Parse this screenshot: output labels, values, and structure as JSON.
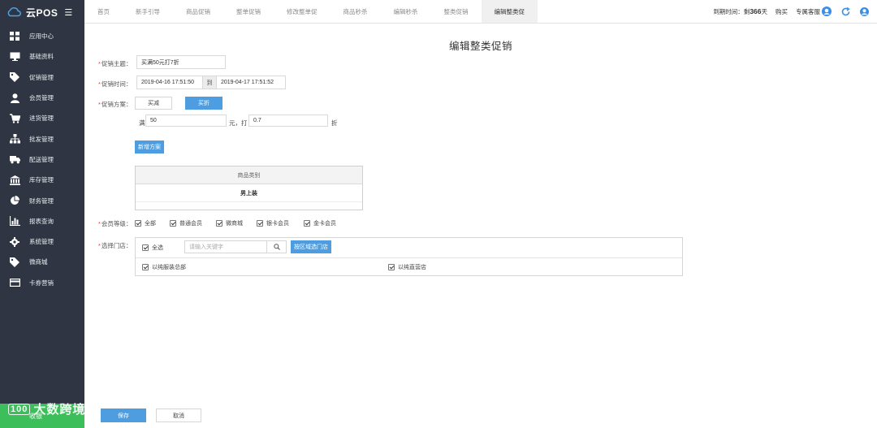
{
  "brand": {
    "name": "云POS"
  },
  "sidebar": {
    "items": [
      {
        "label": "应用中心",
        "icon": "grid-icon"
      },
      {
        "label": "基础资料",
        "icon": "monitor-icon"
      },
      {
        "label": "促销管理",
        "icon": "tag-icon"
      },
      {
        "label": "会员管理",
        "icon": "user-icon"
      },
      {
        "label": "进货管理",
        "icon": "cart-icon"
      },
      {
        "label": "批发管理",
        "icon": "org-chart-icon"
      },
      {
        "label": "配送管理",
        "icon": "truck-icon"
      },
      {
        "label": "库存管理",
        "icon": "bank-icon"
      },
      {
        "label": "财务管理",
        "icon": "pie-chart-icon"
      },
      {
        "label": "报表查询",
        "icon": "bar-chart-icon"
      },
      {
        "label": "系统管理",
        "icon": "gear-icon"
      },
      {
        "label": "微商城",
        "icon": "tag-icon"
      },
      {
        "label": "卡券营销",
        "icon": "card-icon"
      }
    ],
    "cashier_label": "收银"
  },
  "topbar": {
    "tabs": [
      {
        "label": "首页",
        "active": false
      },
      {
        "label": "新手引导",
        "active": false
      },
      {
        "label": "商品促销",
        "active": false
      },
      {
        "label": "整单促销",
        "active": false
      },
      {
        "label": "修改整单促",
        "active": false
      },
      {
        "label": "商品秒杀",
        "active": false
      },
      {
        "label": "编辑秒杀",
        "active": false
      },
      {
        "label": "整类促销",
        "active": false
      },
      {
        "label": "编辑整类促",
        "active": true
      }
    ],
    "expiry_prefix": "到期时间：剩",
    "expiry_days": "366",
    "expiry_suffix": "天",
    "renew_label": "购买",
    "support_label": "专属客服"
  },
  "page": {
    "title": "编辑整类促销",
    "theme": {
      "label": "促销主题：",
      "value": "买满50元打7折"
    },
    "time": {
      "label": "促销时间：",
      "start": "2019-04-16 17:51:50",
      "to": "到",
      "end": "2019-04-17 17:51:52"
    },
    "scheme": {
      "label": "促销方案：",
      "options": [
        "买减",
        "买折"
      ],
      "selected": "买折",
      "prefix": "满",
      "amount": "50",
      "mid": "元，打",
      "discount": "0.7",
      "suffix": "折"
    },
    "add_scheme_label": "新增方案",
    "category_table": {
      "header": "商品类别",
      "rows": [
        "男上装"
      ]
    },
    "member_level": {
      "label": "会员等级：",
      "options": [
        {
          "label": "全部",
          "checked": true
        },
        {
          "label": "普通会员",
          "checked": true
        },
        {
          "label": "微商城",
          "checked": true
        },
        {
          "label": "银卡会员",
          "checked": true
        },
        {
          "label": "金卡会员",
          "checked": true
        }
      ]
    },
    "stores": {
      "label": "选择门店：",
      "select_all": "全选",
      "search_placeholder": "请输入关键字",
      "filter_button": "按区域选门店",
      "items": [
        {
          "label": "以纯服装总部",
          "checked": true
        },
        {
          "label": "以纯直营店",
          "checked": true
        }
      ]
    },
    "save_label": "保存",
    "cancel_label": "取消"
  },
  "watermark": {
    "text": "大数跨境",
    "logo": "100"
  }
}
